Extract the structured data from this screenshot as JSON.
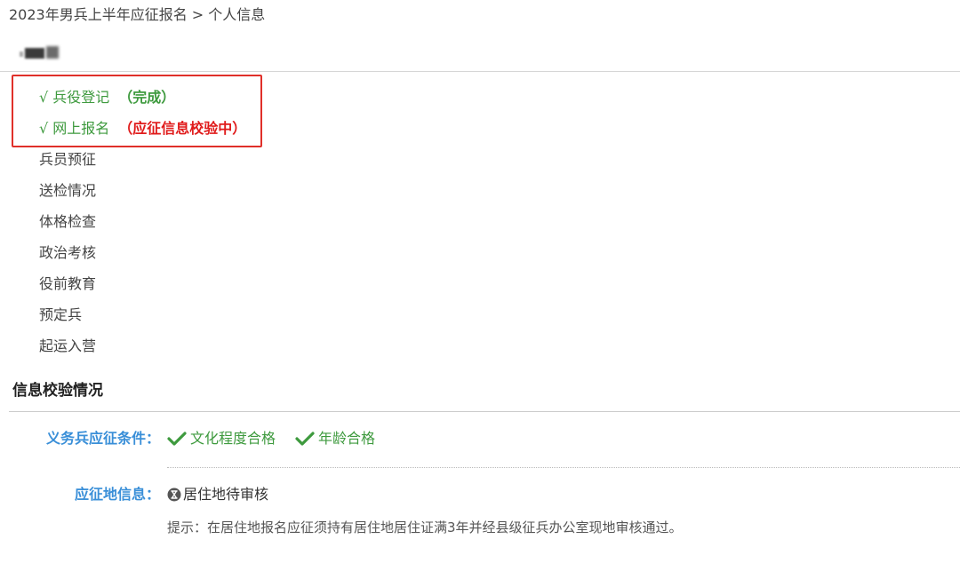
{
  "breadcrumb": "2023年男兵上半年应征报名 > 个人信息",
  "steps": [
    {
      "label": "√ 兵役登记",
      "status": "（完成）",
      "status_color": "#3e9a3e"
    },
    {
      "label": "√ 网上报名",
      "status": "（应征信息校验中）",
      "status_color": "#e01b1b"
    },
    {
      "label": "兵员预征"
    },
    {
      "label": "送检情况"
    },
    {
      "label": "体格检查"
    },
    {
      "label": "政治考核"
    },
    {
      "label": "役前教育"
    },
    {
      "label": "预定兵"
    },
    {
      "label": "起运入营"
    }
  ],
  "section": {
    "title": "信息校验情况"
  },
  "conditions": {
    "label": "义务兵应征条件：",
    "items": [
      {
        "icon": "check-icon",
        "text": "文化程度合格"
      },
      {
        "icon": "check-icon",
        "text": "年龄合格"
      }
    ]
  },
  "place": {
    "label": "应征地信息：",
    "icon": "hourglass-icon",
    "value": "居住地待审核",
    "tip": "提示：在居住地报名应征须持有居住地居住证满3年并经县级征兵办公室现地审核通过。"
  },
  "colors": {
    "done_green": "#3e9a3e",
    "pending_red": "#e01b1b",
    "label_blue": "#3a8fd8",
    "highlight_border": "#e0302a"
  }
}
